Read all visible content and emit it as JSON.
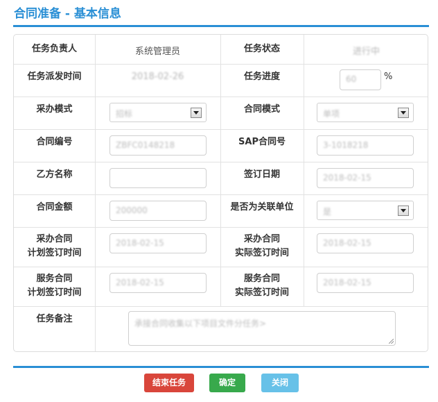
{
  "page": {
    "title": "合同准备 - 基本信息"
  },
  "form": {
    "owner_label": "任务负责人",
    "owner_value": "系统管理员",
    "status_label": "任务状态",
    "status_value": "进行中",
    "dispatch_time_label": "任务派发时间",
    "dispatch_time_value": "2018-02-26",
    "progress_label": "任务进度",
    "progress_value": "60",
    "progress_unit": "%",
    "purchase_mode_label": "采办模式",
    "purchase_mode_value": "招标",
    "contract_mode_label": "合同模式",
    "contract_mode_value": "单项",
    "contract_no_label": "合同编号",
    "contract_no_value": "ZBFC0148218",
    "sap_no_label": "SAP合同号",
    "sap_no_value": "3-1018218",
    "party_b_label": "乙方名称",
    "party_b_value": "",
    "sign_date_label": "签订日期",
    "sign_date_value": "2018-02-15",
    "amount_label": "合同金额",
    "amount_value": "200000",
    "related_label": "是否为关联单位",
    "related_value": "是",
    "purchase_plan_label": "采办合同\n计划签订时间",
    "purchase_plan_value": "2018-02-15",
    "purchase_actual_label": "采办合同\n实际签订时间",
    "purchase_actual_value": "2018-02-15",
    "service_plan_label": "服务合同\n计划签订时间",
    "service_plan_value": "2018-02-15",
    "service_actual_label": "服务合同\n实际签订时间",
    "service_actual_value": "2018-02-15",
    "remark_label": "任务备注",
    "remark_value": "承接合同收集以下项目文件分任务>"
  },
  "actions": {
    "finish_label": "结束任务",
    "confirm_label": "确定",
    "close_label": "关闭"
  },
  "colors": {
    "accent": "#2a8fd5",
    "finish": "#d9463b",
    "confirm": "#38a94c",
    "close": "#67c1e8"
  }
}
